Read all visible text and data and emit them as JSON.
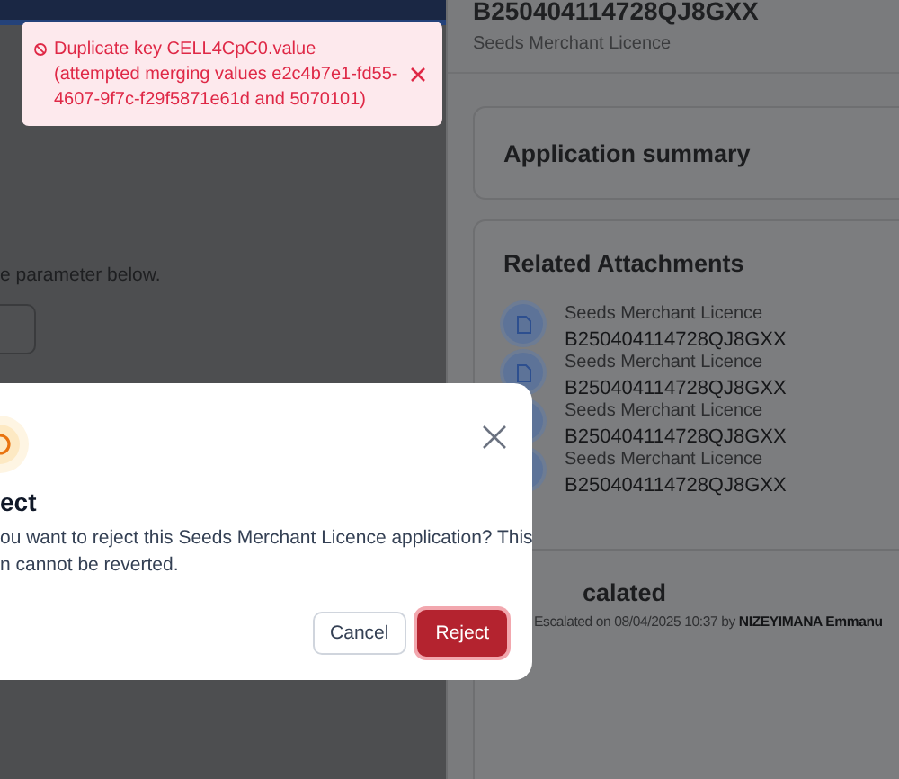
{
  "page": {
    "instruction": "e parameter below."
  },
  "record": {
    "reference": "B250404114728QJ8GXX",
    "licence_type": "Seeds Merchant Licence"
  },
  "summary_card": {
    "title": "Application summary"
  },
  "attachments": {
    "title": "Related Attachments",
    "items": [
      {
        "name": "Seeds Merchant Licence",
        "reference": "B250404114728QJ8GXX"
      },
      {
        "name": "Seeds Merchant Licence",
        "reference": "B250404114728QJ8GXX"
      },
      {
        "name": "Seeds Merchant Licence",
        "reference": "B250404114728QJ8GXX"
      },
      {
        "name": "Seeds Merchant Licence",
        "reference": "B250404114728QJ8GXX"
      }
    ]
  },
  "escalation": {
    "title": "calated",
    "detail": "Escalated on 08/04/2025 10:37 by **NIZEYIMANA Emmanu**"
  },
  "toast": {
    "message": "Duplicate key CELL4CpC0.value (attempted merging values e2c4b7e1-fd55-4607-9f7c-f29f5871e61d and 5070101)"
  },
  "dialog": {
    "title": "ect",
    "body": [
      "ou want to reject this Seeds Merchant Licence application? This",
      "n cannot be reverted."
    ],
    "buttons": [
      {
        "label": "Cancel",
        "kind": "secondary"
      },
      {
        "label": "Reject",
        "kind": "danger"
      }
    ]
  }
}
